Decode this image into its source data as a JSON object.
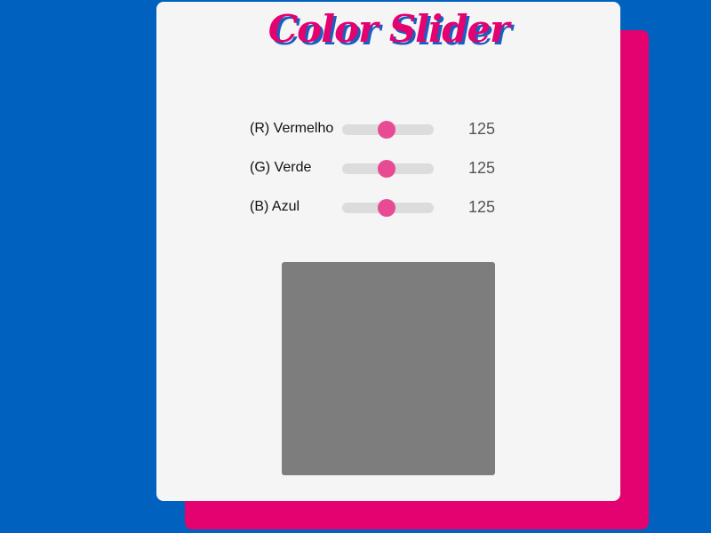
{
  "app": {
    "title": "Color Slider"
  },
  "sliders": [
    {
      "label": "(R) Vermelho",
      "value": "125",
      "level": 0.49
    },
    {
      "label": "(G) Verde",
      "value": "125",
      "level": 0.49
    },
    {
      "label": "(B) Azul",
      "value": "125",
      "level": 0.49
    }
  ],
  "preview": {
    "color": "#7d7d7d"
  },
  "colors": {
    "background": "#0061bf",
    "accent": "#e3026f",
    "thumb": "#e84a94",
    "card": "#f5f5f5"
  }
}
